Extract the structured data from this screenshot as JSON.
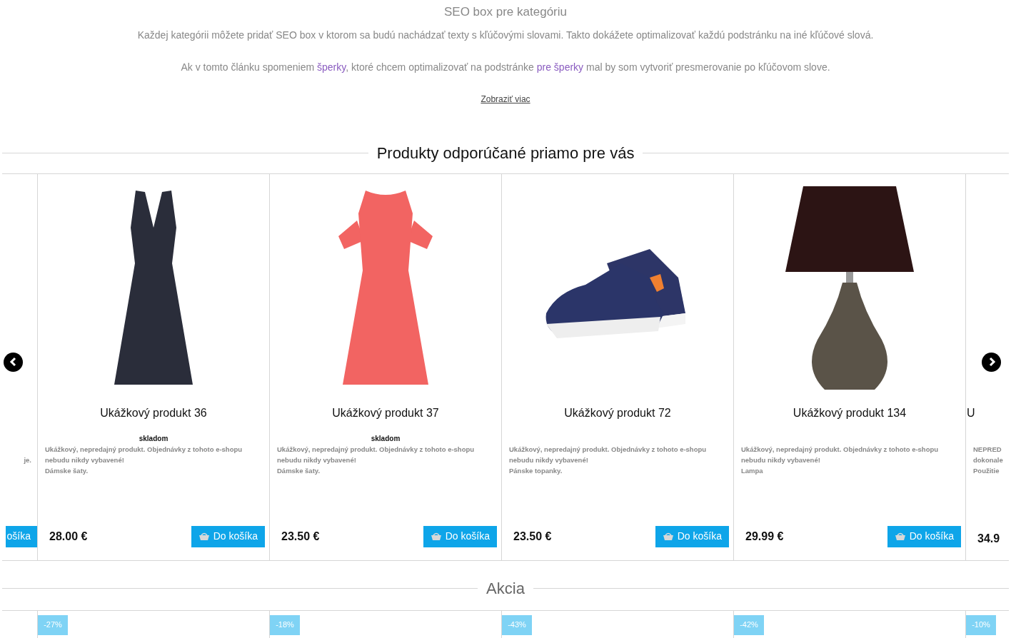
{
  "seo_box": {
    "title": "SEO box pre kategóriu",
    "paragraphs": [
      [
        {
          "text": "Každej kategórii môžete pridať SEO box v ktorom sa budú nachádzať texty s kľúčovými slovami. Takto dokážete optimalizovať každú podstránku na iné kľúčové slová."
        }
      ],
      [
        {
          "text": "Ak v tomto článku spomeniem "
        },
        {
          "text": "šperky",
          "link": true
        },
        {
          "text": ", ktoré chcem optimalizovať na podstránke "
        },
        {
          "text": "pre šperky",
          "link": true
        },
        {
          "text": " mal by som vytvoriť presmerovanie po kľúčovom slove."
        }
      ]
    ],
    "show_more": "Zobraziť viac"
  },
  "recommended": {
    "title": "Produkty odporúčané priamo pre vás",
    "products": [
      {
        "kind": "partial-left",
        "description": [
          "je."
        ],
        "button": "ošíka"
      },
      {
        "kind": "dress-dark",
        "title": "Ukážkový produkt 36",
        "stock": "skladom",
        "description": [
          "Ukážkový, nepredajný produkt. Objednávky z tohoto e-shopu nebudu nikdy vybavené!",
          "Dámske šaty."
        ],
        "price": "28.00 €",
        "button": "Do košíka"
      },
      {
        "kind": "dress-coral",
        "title": "Ukážkový produkt 37",
        "stock": "skladom",
        "description": [
          "Ukážkový, nepredajný produkt. Objednávky z tohoto e-shopu nebudu nikdy vybavené!",
          "Dámske šaty."
        ],
        "price": "23.50 €",
        "button": "Do košíka"
      },
      {
        "kind": "sneaker",
        "title": "Ukážkový produkt 72",
        "description": [
          "Ukážkový, nepredajný produkt. Objednávky z tohoto e-shopu nebudu nikdy vybavené!",
          "Pánske topanky."
        ],
        "price": "23.50 €",
        "button": "Do košíka"
      },
      {
        "kind": "lamp",
        "title": "Ukážkový produkt 134",
        "description": [
          "Ukážkový, nepredajný produkt. Objednávky z tohoto e-shopu nebudu nikdy vybavené!",
          "Lampa"
        ],
        "price": "29.99 €",
        "button": "Do košíka"
      },
      {
        "kind": "partial-right",
        "title": "U",
        "description": [
          "NEPRED",
          "dokonale",
          "Použitie"
        ],
        "price": "34.9"
      }
    ]
  },
  "sale": {
    "title": "Akcia",
    "badges": [
      "-27%",
      "-18%",
      "-43%",
      "-42%",
      "-10%"
    ]
  }
}
